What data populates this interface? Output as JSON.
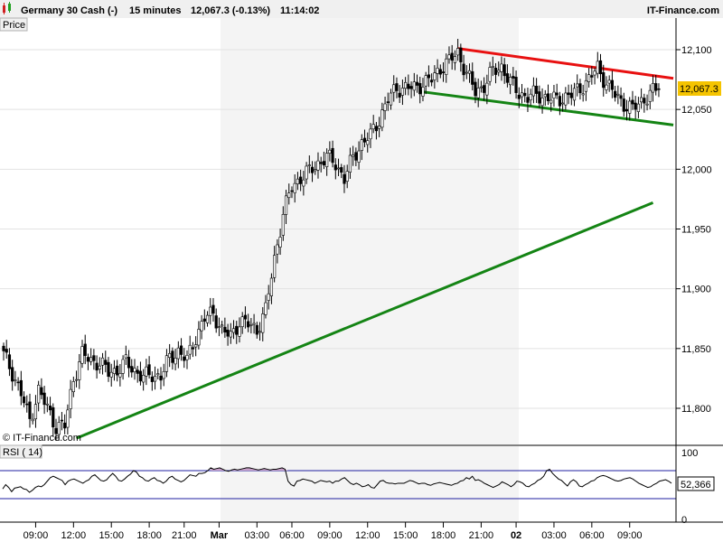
{
  "header": {
    "instrument": "Germany 30 Cash (-)",
    "timeframe": "15 minutes",
    "quote": "12,067.3 (-0.13%)",
    "time": "11:14:02",
    "brand": "IT-Finance.com"
  },
  "colors": {
    "red_trend": "#e81010",
    "green_trend": "#148414",
    "rsi_fill": "#c8a0c8",
    "rsi_band": "#2020a0",
    "last_price_bg": "#f5c400"
  },
  "chart_data": [
    {
      "type": "candlestick",
      "panel_label": "Price",
      "copyright": "© IT-Finance.com",
      "x_ticks": [
        "09:00",
        "12:00",
        "15:00",
        "18:00",
        "21:00",
        "Mar",
        "03:00",
        "06:00",
        "09:00",
        "12:00",
        "15:00",
        "18:00",
        "21:00",
        "02",
        "03:00",
        "06:00",
        "09:00"
      ],
      "bold_ticks": [
        "Mar",
        "02"
      ],
      "y_ticks": [
        "12,100",
        "12,050",
        "12,000",
        "11,950",
        "11,900",
        "11,850",
        "11,800"
      ],
      "ylim": [
        11,
        772,
        12,
        125
      ],
      "last_price": 12067.3,
      "last_price_label": "12,067.3",
      "path": [
        [
          0,
          11845
        ],
        [
          3,
          11830
        ],
        [
          6,
          11812
        ],
        [
          9,
          11790
        ],
        [
          12,
          11815
        ],
        [
          15,
          11800
        ],
        [
          18,
          11785
        ],
        [
          21,
          11785
        ],
        [
          24,
          11825
        ],
        [
          27,
          11845
        ],
        [
          30,
          11840
        ],
        [
          33,
          11838
        ],
        [
          36,
          11830
        ],
        [
          39,
          11832
        ],
        [
          42,
          11838
        ],
        [
          45,
          11832
        ],
        [
          48,
          11826
        ],
        [
          51,
          11828
        ],
        [
          54,
          11827
        ],
        [
          57,
          11842
        ],
        [
          60,
          11848
        ],
        [
          63,
          11840
        ],
        [
          66,
          11860
        ],
        [
          69,
          11875
        ],
        [
          72,
          11880
        ],
        [
          75,
          11865
        ],
        [
          78,
          11860
        ],
        [
          81,
          11873
        ],
        [
          84,
          11870
        ],
        [
          87,
          11866
        ],
        [
          90,
          11882
        ],
        [
          93,
          11925
        ],
        [
          96,
          11963
        ],
        [
          99,
          11985
        ],
        [
          102,
          11993
        ],
        [
          105,
          11998
        ],
        [
          108,
          12005
        ],
        [
          111,
          12010
        ],
        [
          114,
          12005
        ],
        [
          117,
          11992
        ],
        [
          120,
          12010
        ],
        [
          123,
          12022
        ],
        [
          126,
          12028
        ],
        [
          129,
          12042
        ],
        [
          132,
          12058
        ],
        [
          135,
          12068
        ],
        [
          138,
          12068
        ],
        [
          141,
          12068
        ],
        [
          144,
          12072
        ],
        [
          147,
          12075
        ],
        [
          150,
          12085
        ],
        [
          153,
          12090
        ],
        [
          156,
          12098
        ],
        [
          159,
          12080
        ],
        [
          162,
          12065
        ],
        [
          165,
          12070
        ],
        [
          168,
          12082
        ],
        [
          171,
          12086
        ],
        [
          174,
          12072
        ],
        [
          177,
          12064
        ],
        [
          180,
          12060
        ],
        [
          183,
          12063
        ],
        [
          186,
          12060
        ],
        [
          189,
          12058
        ],
        [
          192,
          12060
        ],
        [
          195,
          12062
        ],
        [
          198,
          12068
        ],
        [
          201,
          12075
        ],
        [
          204,
          12085
        ],
        [
          207,
          12072
        ],
        [
          210,
          12062
        ],
        [
          213,
          12055
        ],
        [
          216,
          12050
        ],
        [
          219,
          12057
        ],
        [
          222,
          12063
        ],
        [
          225,
          12068
        ]
      ],
      "trend_lines": [
        {
          "color": "red",
          "x1": 156,
          "y1": 12101,
          "x2": 230,
          "y2": 12076
        },
        {
          "color": "green",
          "x1": 143,
          "y1": 12065,
          "x2": 230,
          "y2": 12037
        },
        {
          "color": "green",
          "x1": 25,
          "y1": 11775,
          "x2": 223,
          "y2": 11972
        }
      ]
    },
    {
      "type": "line",
      "panel_label": "RSI ( 14)",
      "ylim": [
        0,
        100
      ],
      "y_ticks": [
        "100",
        "0"
      ],
      "bands": [
        30,
        70
      ],
      "last_value": 52.366,
      "last_value_label": "52,366",
      "values": [
        44,
        50,
        46,
        40,
        45,
        46,
        47,
        44,
        43,
        39,
        42,
        46,
        48,
        47,
        50,
        55,
        60,
        62,
        60,
        58,
        56,
        50,
        55,
        57,
        58,
        56,
        54,
        52,
        55,
        57,
        62,
        64,
        60,
        56,
        55,
        57,
        62,
        66,
        62,
        56,
        55,
        58,
        62,
        65,
        70,
        68,
        62,
        60,
        56,
        55,
        58,
        60,
        56,
        55,
        52,
        55,
        60,
        62,
        58,
        56,
        54,
        56,
        60,
        64,
        63,
        62,
        66,
        66,
        67,
        70,
        74,
        72,
        73,
        74,
        72,
        70,
        69,
        71,
        72,
        71,
        72,
        73,
        74,
        74,
        73,
        72,
        71,
        72,
        73,
        72,
        71,
        72,
        72,
        73,
        74,
        72,
        55,
        50,
        48,
        55,
        56,
        58,
        57,
        56,
        55,
        52,
        54,
        56,
        55,
        54,
        55,
        52,
        55,
        55,
        58,
        60,
        56,
        52,
        50,
        52,
        50,
        47,
        48,
        50,
        46,
        45,
        50,
        55,
        56,
        53,
        52,
        52,
        51,
        52,
        52,
        52,
        54,
        56,
        55,
        53,
        51,
        52,
        52,
        50,
        49,
        51,
        52,
        53,
        52,
        51,
        50,
        49,
        51,
        52,
        55,
        56,
        60,
        58,
        62,
        56,
        57,
        55,
        52,
        50,
        48,
        46,
        48,
        50,
        54,
        52,
        50,
        47,
        50,
        55,
        54,
        52,
        48,
        47,
        50,
        52,
        56,
        58,
        62,
        70,
        72,
        66,
        62,
        58,
        56,
        52,
        48,
        54,
        57,
        54,
        48,
        47,
        50,
        52,
        55,
        56,
        60,
        62,
        63,
        62,
        60,
        58,
        56,
        55,
        56,
        58,
        59,
        60,
        58,
        55,
        52,
        50,
        48,
        46,
        47,
        50,
        52,
        55,
        56,
        57,
        55,
        52
      ]
    }
  ]
}
